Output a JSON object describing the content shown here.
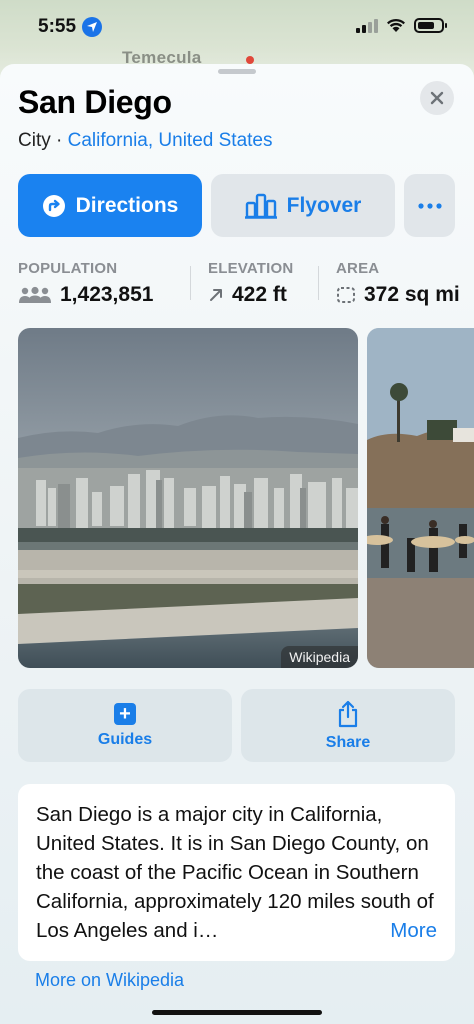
{
  "status_bar": {
    "time": "5:55"
  },
  "map": {
    "label": "Temecula"
  },
  "place": {
    "title": "San Diego",
    "subtitle_prefix": "City · ",
    "subtitle_link": "California, United States"
  },
  "actions": {
    "directions_label": "Directions",
    "flyover_label": "Flyover",
    "more_label": "•••"
  },
  "stats": {
    "population_label": "POPULATION",
    "population_value": "1,423,851",
    "elevation_label": "ELEVATION",
    "elevation_value": "422 ft",
    "area_label": "AREA",
    "area_value": "372 sq mi"
  },
  "photos": {
    "credit": "Wikipedia"
  },
  "tiles": {
    "guides_label": "Guides",
    "share_label": "Share"
  },
  "description": {
    "text": "San Diego is a major city in California, United States. It is in San Diego County, on the coast of the Pacific Ocean in Southern California, approximately 120 miles south of Los Angeles and i…",
    "more_label": "More"
  },
  "wiki_link": "More on Wikipedia",
  "colors": {
    "accent": "#1a7ee8",
    "primary_button": "#1a82f0",
    "secondary_button": "#e1e6ea"
  }
}
